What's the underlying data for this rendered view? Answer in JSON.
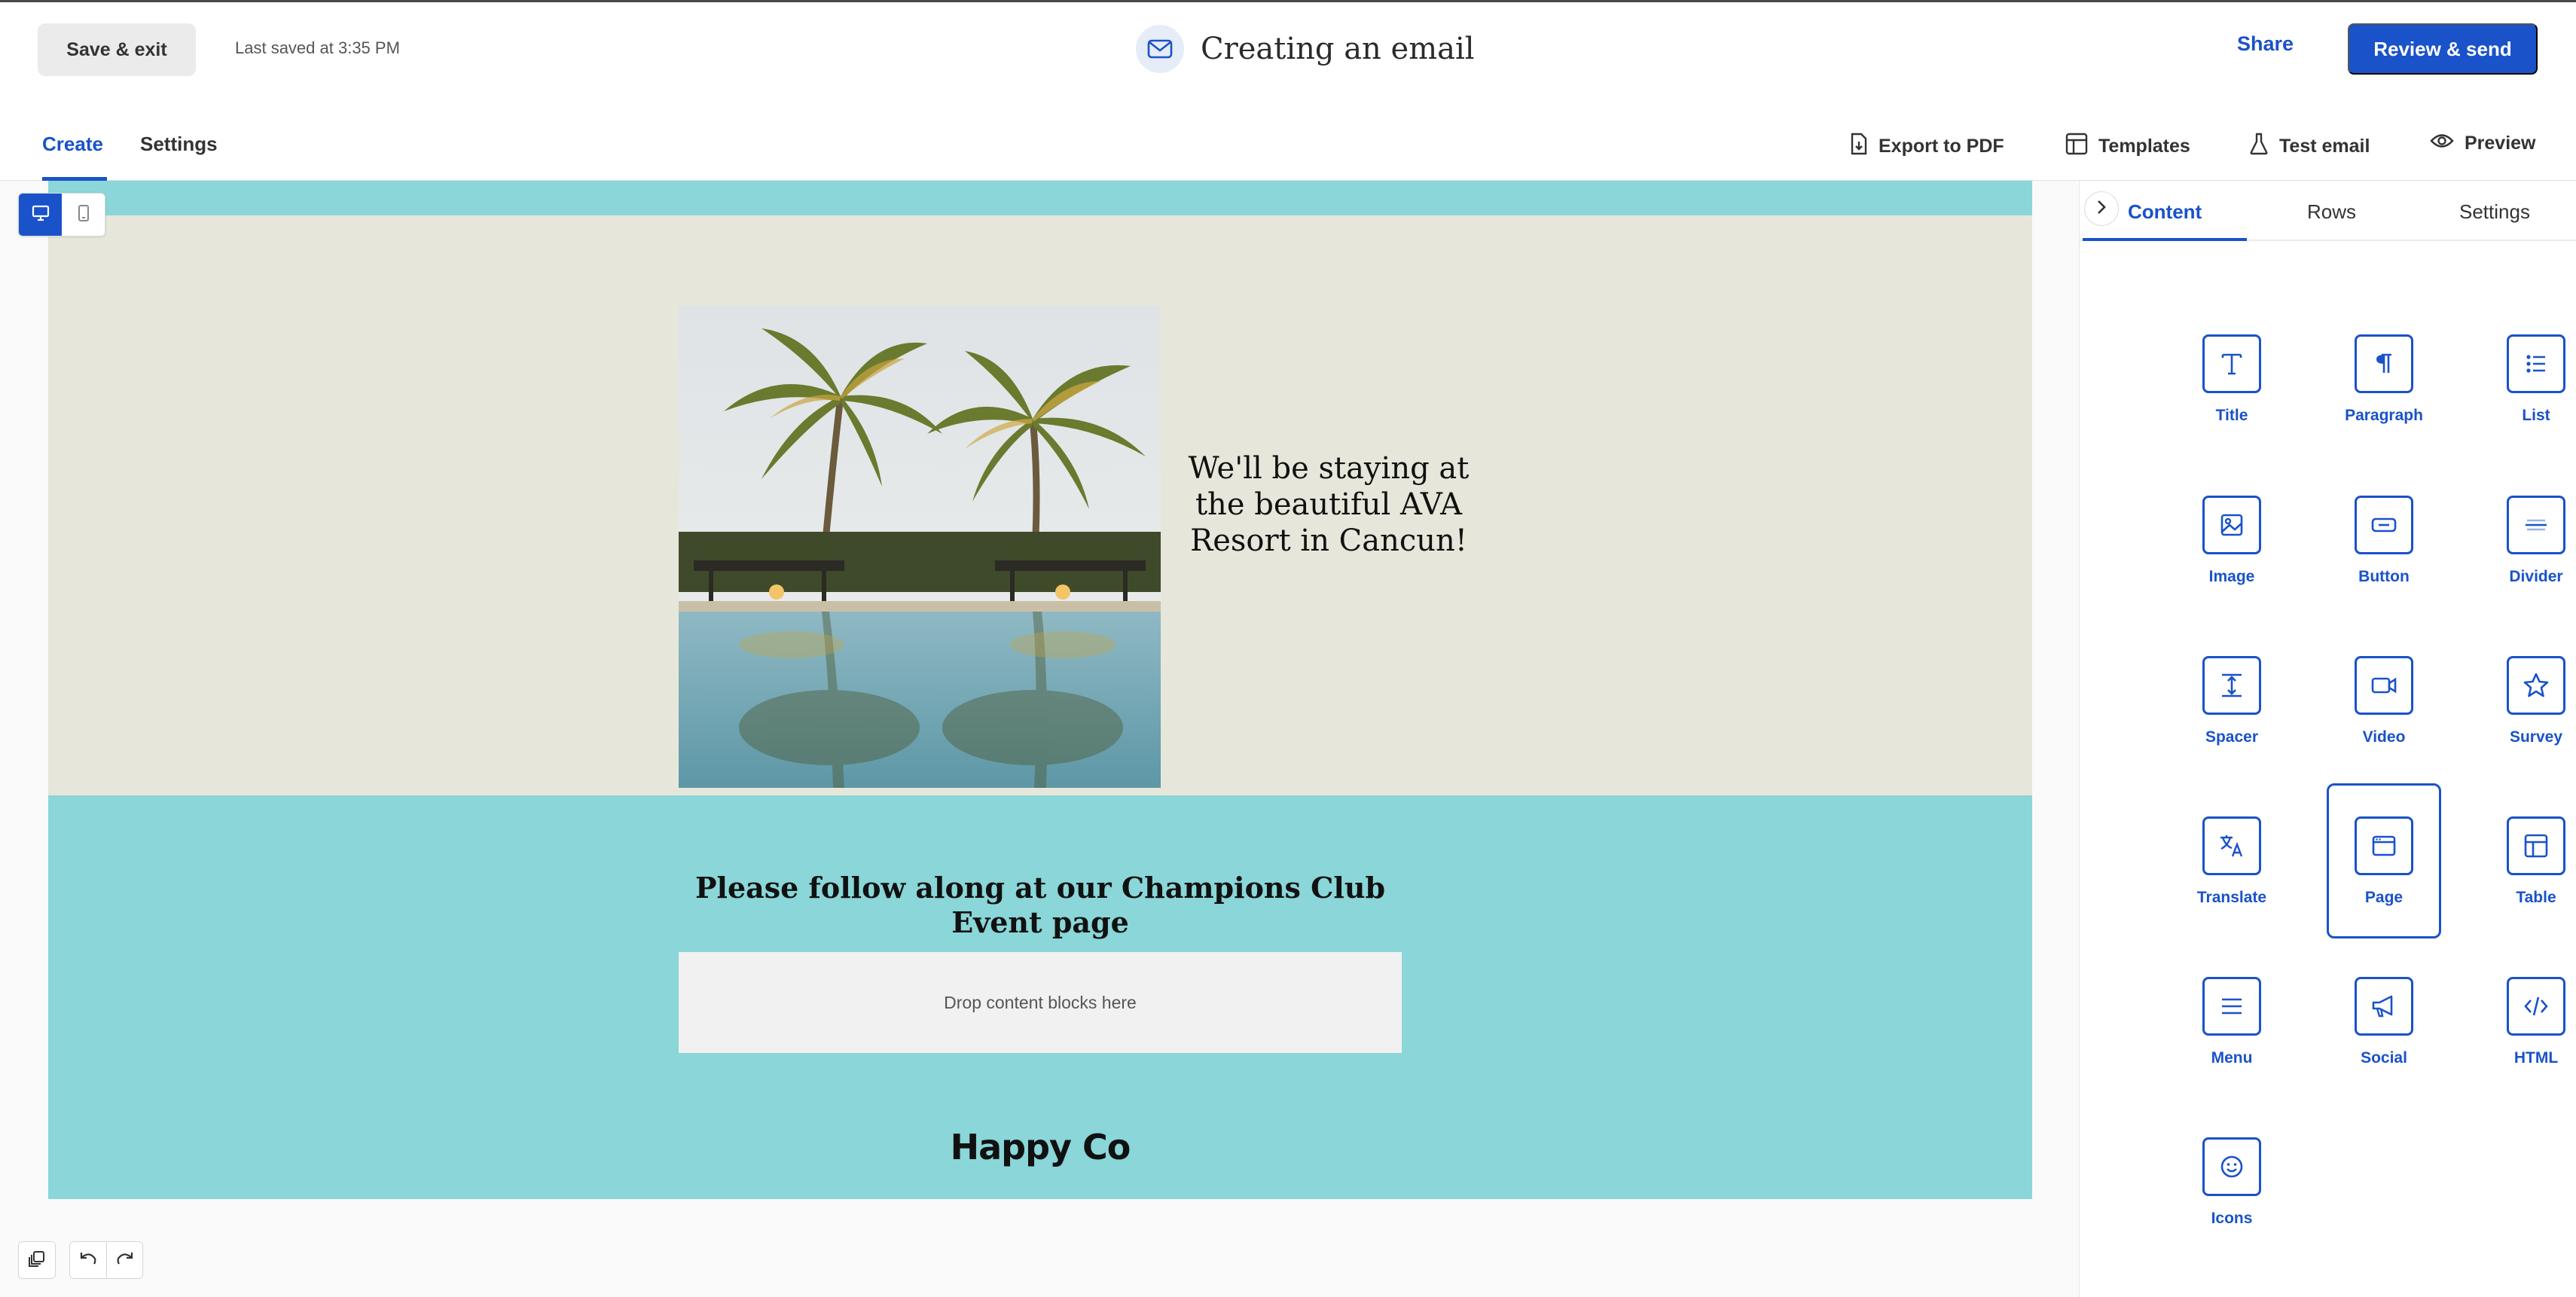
{
  "header": {
    "save_exit_label": "Save & exit",
    "last_saved": "Last saved at 3:35 PM",
    "title": "Creating an email",
    "title_icon": "envelope-icon",
    "share_label": "Share",
    "review_send_label": "Review & send"
  },
  "tabs": {
    "create": "Create",
    "settings": "Settings"
  },
  "tools": {
    "export_pdf": "Export to PDF",
    "templates": "Templates",
    "test_email": "Test email",
    "preview": "Preview"
  },
  "email": {
    "hero_text": "We'll be staying at the beautiful AVA Resort in Cancun!",
    "follow_text": "Please follow along at our Champions Club Event page",
    "drop_zone": "Drop content blocks here",
    "logo": "Happy Co",
    "colors": {
      "accent": "#8ad6d8",
      "hero_bg": "#e6e7da"
    }
  },
  "panel": {
    "tabs": {
      "content": "Content",
      "rows": "Rows",
      "settings": "Settings"
    },
    "blocks": [
      {
        "label": "Title",
        "icon": "title-icon"
      },
      {
        "label": "Paragraph",
        "icon": "paragraph-icon"
      },
      {
        "label": "List",
        "icon": "list-icon"
      },
      {
        "label": "Image",
        "icon": "image-icon"
      },
      {
        "label": "Button",
        "icon": "button-icon"
      },
      {
        "label": "Divider",
        "icon": "divider-icon"
      },
      {
        "label": "Spacer",
        "icon": "spacer-icon"
      },
      {
        "label": "Video",
        "icon": "video-icon"
      },
      {
        "label": "Survey",
        "icon": "star-icon"
      },
      {
        "label": "Translate",
        "icon": "translate-icon"
      },
      {
        "label": "Page",
        "icon": "page-icon",
        "selected": true
      },
      {
        "label": "Table",
        "icon": "table-icon"
      },
      {
        "label": "Menu",
        "icon": "menu-icon"
      },
      {
        "label": "Social",
        "icon": "megaphone-icon"
      },
      {
        "label": "HTML",
        "icon": "code-icon"
      },
      {
        "label": "Icons",
        "icon": "smiley-icon"
      }
    ]
  },
  "theme": {
    "primary": "#1a52c9"
  }
}
